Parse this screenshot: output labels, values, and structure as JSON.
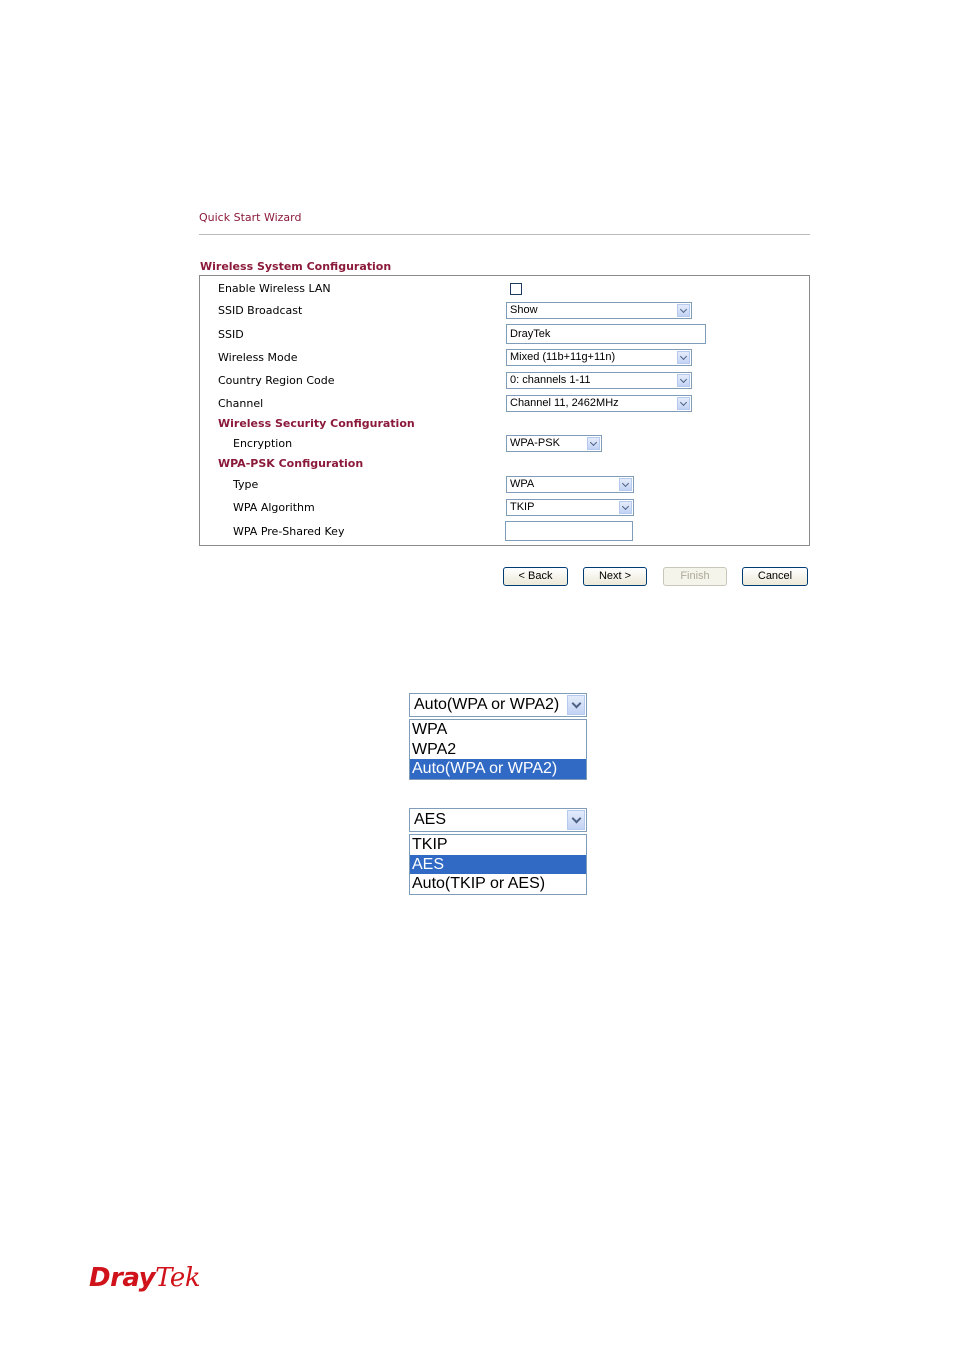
{
  "wizard": {
    "title": "Quick Start Wizard",
    "section_title": "Wireless System Configuration"
  },
  "form": {
    "enable_wireless_lan": {
      "label": "Enable Wireless LAN",
      "checked": false
    },
    "ssid_broadcast": {
      "label": "SSID Broadcast",
      "value": "Show"
    },
    "ssid": {
      "label": "SSID",
      "value": "DrayTek"
    },
    "wireless_mode": {
      "label": "Wireless Mode",
      "value": "Mixed (11b+11g+11n)"
    },
    "country_region_code": {
      "label": "Country Region Code",
      "value": "0: channels 1-11"
    },
    "channel": {
      "label": "Channel",
      "value": "Channel 11, 2462MHz"
    },
    "security_section_title": "Wireless Security Configuration",
    "encryption": {
      "label": "Encryption",
      "value": "WPA-PSK"
    },
    "wpa_psk_section_title": "WPA-PSK Configuration",
    "type": {
      "label": "Type",
      "value": "WPA"
    },
    "wpa_algorithm": {
      "label": "WPA Algorithm",
      "value": "TKIP"
    },
    "wpa_pre_shared_key": {
      "label": "WPA Pre-Shared Key",
      "value": ""
    }
  },
  "buttons": {
    "back": "< Back",
    "next": "Next >",
    "finish": "Finish",
    "cancel": "Cancel"
  },
  "type_dropdown": {
    "selected": "Auto(WPA or WPA2)",
    "options": [
      "WPA",
      "WPA2",
      "Auto(WPA or WPA2)"
    ],
    "highlighted_index": 2
  },
  "algorithm_dropdown": {
    "selected": "AES",
    "options": [
      "TKIP",
      "AES",
      "Auto(TKIP or AES)"
    ],
    "highlighted_index": 1
  },
  "footer": {
    "logo_part1": "Dray",
    "logo_part2": "Tek",
    "logo_color": "#d0121b"
  },
  "colors": {
    "title_accent": "#8b1a3a",
    "selection_highlight": "#316ac5"
  }
}
